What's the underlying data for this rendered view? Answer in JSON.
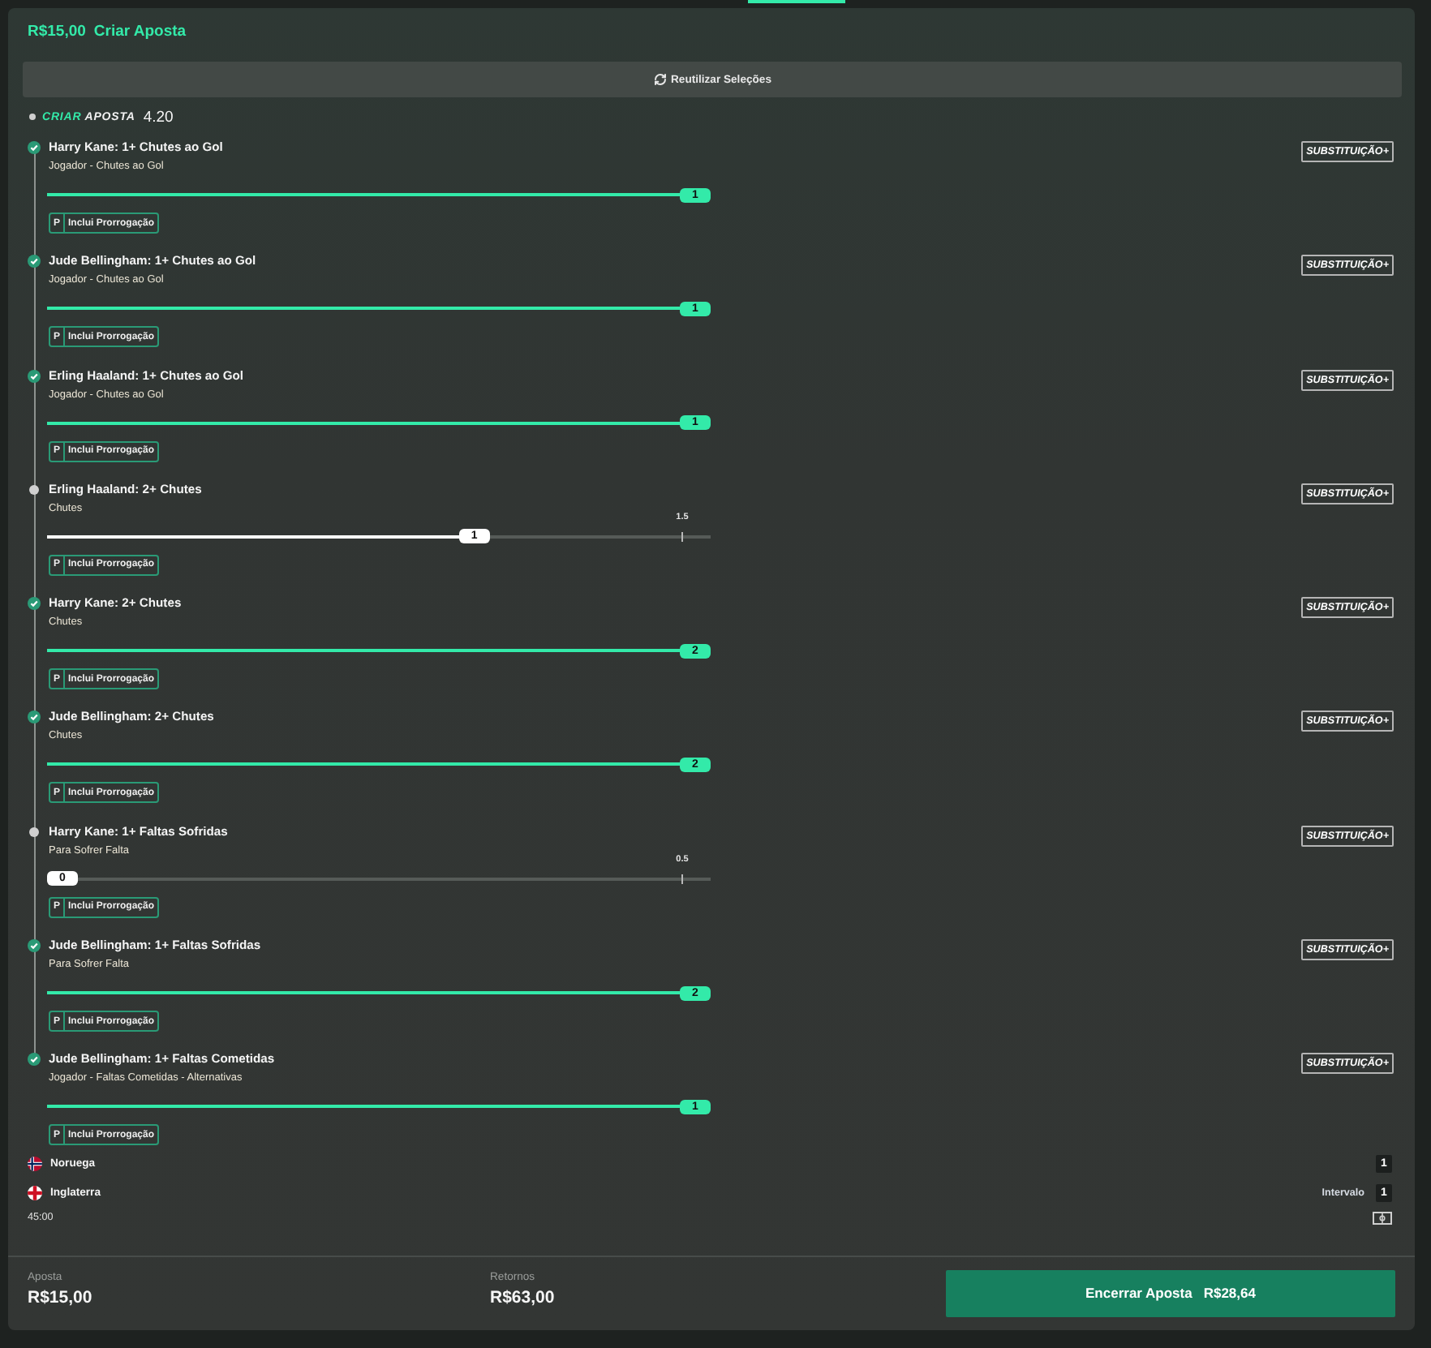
{
  "header": {
    "stake": "R$15,00",
    "title": "Criar Aposta"
  },
  "reuse_button": {
    "label": "Reutilizar Seleções"
  },
  "builder": {
    "label_accent": "CRIAR",
    "label_rest": "APOSTA",
    "odds": "4.20"
  },
  "legs": [
    {
      "title": "Harry Kane: 1+ Chutes ao Gol",
      "subtitle": "Jogador - Chutes ao Gol",
      "won": true,
      "level": 1,
      "value": "1",
      "tag_letter": "P",
      "tag_label": "Inclui Prorrogação",
      "action": "SUBSTITUIÇÃO+"
    },
    {
      "title": "Jude Bellingham: 1+ Chutes ao Gol",
      "subtitle": "Jogador - Chutes ao Gol",
      "won": true,
      "level": 1,
      "value": "1",
      "tag_letter": "P",
      "tag_label": "Inclui Prorrogação",
      "action": "SUBSTITUIÇÃO+"
    },
    {
      "title": "Erling Haaland: 1+ Chutes ao Gol",
      "subtitle": "Jogador - Chutes ao Gol",
      "won": true,
      "level": 1,
      "value": "1",
      "tag_letter": "P",
      "tag_label": "Inclui Prorrogação",
      "action": "SUBSTITUIÇÃO+"
    },
    {
      "title": "Erling Haaland: 2+ Chutes",
      "subtitle": "Chutes",
      "won": false,
      "level": 0.667,
      "value": "1",
      "target": "1.5",
      "tag_letter": "P",
      "tag_label": "Inclui Prorrogação",
      "action": "SUBSTITUIÇÃO+"
    },
    {
      "title": "Harry Kane: 2+ Chutes",
      "subtitle": "Chutes",
      "won": true,
      "level": 1,
      "value": "2",
      "tag_letter": "P",
      "tag_label": "Inclui Prorrogação",
      "action": "SUBSTITUIÇÃO+"
    },
    {
      "title": "Jude Bellingham: 2+ Chutes",
      "subtitle": "Chutes",
      "won": true,
      "level": 1,
      "value": "2",
      "tag_letter": "P",
      "tag_label": "Inclui Prorrogação",
      "action": "SUBSTITUIÇÃO+"
    },
    {
      "title": "Harry Kane: 1+ Faltas Sofridas",
      "subtitle": "Para Sofrer Falta",
      "won": false,
      "level": 0,
      "value": "0",
      "target": "0.5",
      "tag_letter": "P",
      "tag_label": "Inclui Prorrogação",
      "action": "SUBSTITUIÇÃO+"
    },
    {
      "title": "Jude Bellingham: 1+ Faltas Sofridas",
      "subtitle": "Para Sofrer Falta",
      "won": true,
      "level": 1,
      "value": "2",
      "tag_letter": "P",
      "tag_label": "Inclui Prorrogação",
      "action": "SUBSTITUIÇÃO+"
    },
    {
      "title": "Jude Bellingham: 1+ Faltas Cometidas",
      "subtitle": "Jogador - Faltas Cometidas - Alternativas",
      "won": true,
      "level": 1,
      "value": "1",
      "tag_letter": "P",
      "tag_label": "Inclui Prorrogação",
      "action": "SUBSTITUIÇÃO+"
    }
  ],
  "match": {
    "teams": [
      {
        "name": "Noruega",
        "kind": "norway",
        "score": "1"
      },
      {
        "name": "Inglaterra",
        "kind": "england",
        "score": "1"
      }
    ],
    "status": "Intervalo",
    "clock": "45:00"
  },
  "footer": {
    "stake_label": "Aposta",
    "stake_value": "R$15,00",
    "returns_label": "Retornos",
    "returns_value": "R$63,00",
    "cashout_label": "Encerrar Aposta",
    "cashout_amount": "R$28,64"
  }
}
